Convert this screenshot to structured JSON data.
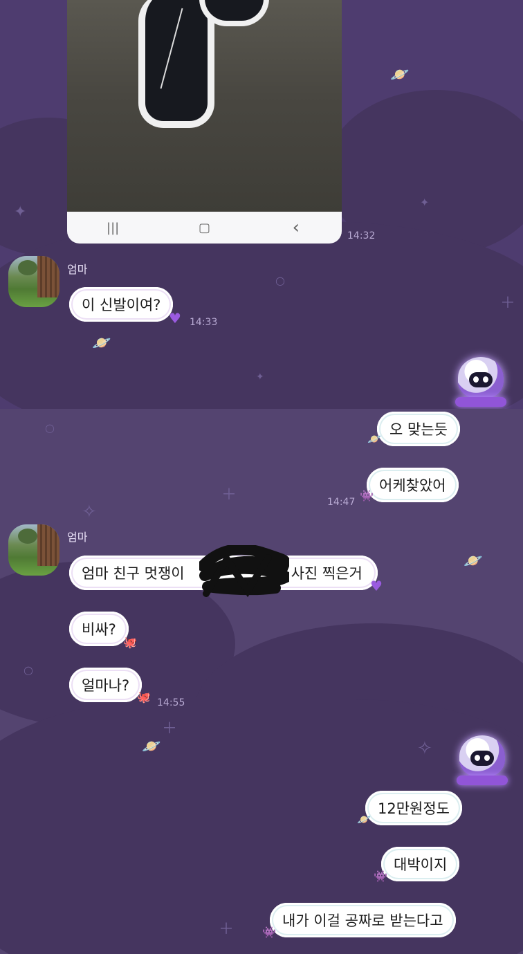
{
  "screenshot_top": {
    "photo_time": "14:32",
    "navbar": {
      "recent": "|||",
      "home": "▢",
      "back": "‹"
    },
    "incoming": {
      "sender": "엄마",
      "message": "이 신발이여?",
      "time": "14:33"
    }
  },
  "screenshot_bottom": {
    "outgoing_1": [
      {
        "text": "오 맞는듯"
      },
      {
        "text": "어케찾았어"
      }
    ],
    "outgoing_1_time": "14:47",
    "incoming": {
      "sender": "엄마",
      "messages": [
        {
          "text_left": "엄마  친구 멋쟁이",
          "text_right": "고 사진 찍은거"
        },
        {
          "text": "비싸?"
        },
        {
          "text": "얼마나?"
        }
      ],
      "time": "14:55"
    },
    "outgoing_2": [
      {
        "text": "12만원정도"
      },
      {
        "text": "대박이지"
      },
      {
        "text": "내가 이걸 공짜로 받는다고"
      }
    ]
  },
  "icons": {
    "heart": "purple-heart-icon",
    "planet": "planet-sticker-icon",
    "bug": "alien-sticker-icon",
    "octopus": "octopus-sticker-icon",
    "mascot": "astronaut-mascot-icon"
  },
  "colors": {
    "bg_top": "#4e3c6f",
    "bg_bottom": "#544470",
    "bubble": "#ffffff",
    "time_text": "#b7a9d2",
    "sender_text": "#e6def4"
  }
}
